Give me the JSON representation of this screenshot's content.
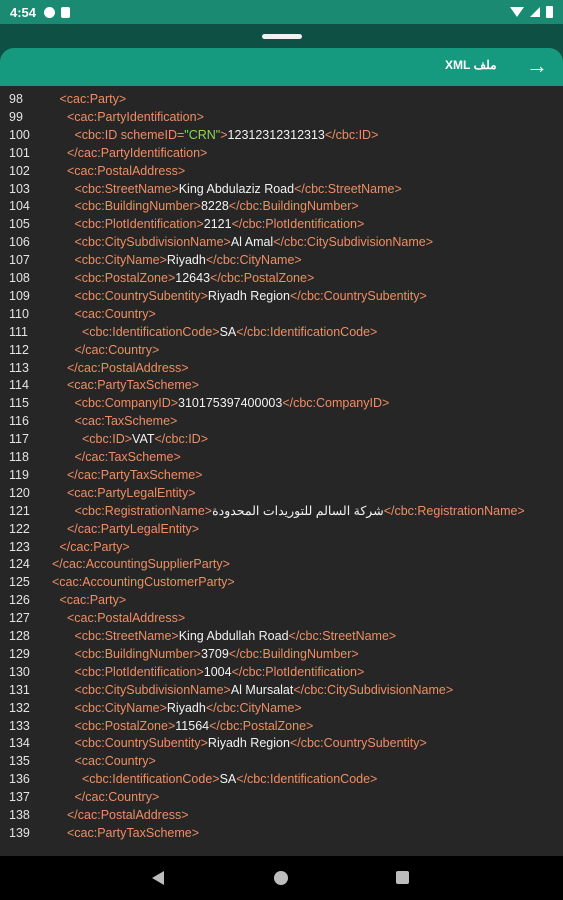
{
  "status_bar": {
    "time": "4:54"
  },
  "sheet": {
    "title": "ملف XML"
  },
  "icons": {
    "back": "arrow-right-icon",
    "nav_back": "nav-back-icon",
    "nav_home": "nav-home-icon",
    "nav_recent": "nav-recent-icon"
  },
  "colors": {
    "status_bar": "#1a8a72",
    "header": "#15997f",
    "code_bg": "#262626",
    "tag": "#ee8e64",
    "attribute_value": "#8fd45a",
    "text": "#f2f2f2"
  },
  "lines": [
    {
      "n": "98",
      "indent": 1,
      "p": [
        [
          "t",
          "<cac:Party>"
        ]
      ]
    },
    {
      "n": "99",
      "indent": 2,
      "p": [
        [
          "t",
          "<cac:PartyIdentification>"
        ]
      ]
    },
    {
      "n": "100",
      "indent": 3,
      "p": [
        [
          "t",
          "<cbc:ID schemeID="
        ],
        [
          "v",
          "\"CRN\""
        ],
        [
          "t",
          ">"
        ],
        [
          "x",
          "12312312312313"
        ],
        [
          "t",
          "</cbc:ID>"
        ]
      ]
    },
    {
      "n": "101",
      "indent": 2,
      "p": [
        [
          "t",
          "</cac:PartyIdentification>"
        ]
      ]
    },
    {
      "n": "102",
      "indent": 2,
      "p": [
        [
          "t",
          "<cac:PostalAddress>"
        ]
      ]
    },
    {
      "n": "103",
      "indent": 3,
      "p": [
        [
          "t",
          "<cbc:StreetName>"
        ],
        [
          "x",
          "King Abdulaziz Road"
        ],
        [
          "t",
          "</cbc:StreetName>"
        ]
      ]
    },
    {
      "n": "104",
      "indent": 3,
      "p": [
        [
          "t",
          "<cbc:BuildingNumber>"
        ],
        [
          "x",
          "8228"
        ],
        [
          "t",
          "</cbc:BuildingNumber>"
        ]
      ]
    },
    {
      "n": "105",
      "indent": 3,
      "p": [
        [
          "t",
          "<cbc:PlotIdentification>"
        ],
        [
          "x",
          "2121"
        ],
        [
          "t",
          "</cbc:PlotIdentification>"
        ]
      ]
    },
    {
      "n": "106",
      "indent": 3,
      "p": [
        [
          "t",
          "<cbc:CitySubdivisionName>"
        ],
        [
          "x",
          "Al Amal"
        ],
        [
          "t",
          "</cbc:CitySubdivisionName>"
        ]
      ]
    },
    {
      "n": "107",
      "indent": 3,
      "p": [
        [
          "t",
          "<cbc:CityName>"
        ],
        [
          "x",
          "Riyadh"
        ],
        [
          "t",
          "</cbc:CityName>"
        ]
      ]
    },
    {
      "n": "108",
      "indent": 3,
      "p": [
        [
          "t",
          "<cbc:PostalZone>"
        ],
        [
          "x",
          "12643"
        ],
        [
          "t",
          "</cbc:PostalZone>"
        ]
      ]
    },
    {
      "n": "109",
      "indent": 3,
      "p": [
        [
          "t",
          "<cbc:CountrySubentity>"
        ],
        [
          "x",
          "Riyadh Region"
        ],
        [
          "t",
          "</cbc:CountrySubentity>"
        ]
      ]
    },
    {
      "n": "110",
      "indent": 3,
      "p": [
        [
          "t",
          "<cac:Country>"
        ]
      ]
    },
    {
      "n": "111",
      "indent": 4,
      "p": [
        [
          "t",
          "<cbc:IdentificationCode>"
        ],
        [
          "x",
          "SA"
        ],
        [
          "t",
          "</cbc:IdentificationCode>"
        ]
      ]
    },
    {
      "n": "112",
      "indent": 3,
      "p": [
        [
          "t",
          "</cac:Country>"
        ]
      ]
    },
    {
      "n": "113",
      "indent": 2,
      "p": [
        [
          "t",
          "</cac:PostalAddress>"
        ]
      ]
    },
    {
      "n": "114",
      "indent": 2,
      "p": [
        [
          "t",
          "<cac:PartyTaxScheme>"
        ]
      ]
    },
    {
      "n": "115",
      "indent": 3,
      "p": [
        [
          "t",
          "<cbc:CompanyID>"
        ],
        [
          "x",
          "310175397400003"
        ],
        [
          "t",
          "</cbc:CompanyID>"
        ]
      ]
    },
    {
      "n": "116",
      "indent": 3,
      "p": [
        [
          "t",
          "<cac:TaxScheme>"
        ]
      ]
    },
    {
      "n": "117",
      "indent": 4,
      "p": [
        [
          "t",
          "<cbc:ID>"
        ],
        [
          "x",
          "VAT"
        ],
        [
          "t",
          "</cbc:ID>"
        ]
      ]
    },
    {
      "n": "118",
      "indent": 3,
      "p": [
        [
          "t",
          "</cac:TaxScheme>"
        ]
      ]
    },
    {
      "n": "119",
      "indent": 2,
      "p": [
        [
          "t",
          "</cac:PartyTaxScheme>"
        ]
      ]
    },
    {
      "n": "120",
      "indent": 2,
      "p": [
        [
          "t",
          "<cac:PartyLegalEntity>"
        ]
      ]
    },
    {
      "n": "121",
      "indent": 3,
      "p": [
        [
          "t",
          "<cbc:RegistrationName>"
        ],
        [
          "x",
          "شركة السالم للتوريدات المحدودة"
        ],
        [
          "t",
          "</cbc:RegistrationName>"
        ]
      ]
    },
    {
      "n": "122",
      "indent": 2,
      "p": [
        [
          "t",
          "</cac:PartyLegalEntity>"
        ]
      ]
    },
    {
      "n": "123",
      "indent": 1,
      "p": [
        [
          "t",
          "</cac:Party>"
        ]
      ]
    },
    {
      "n": "124",
      "indent": 0,
      "p": [
        [
          "t",
          "</cac:AccountingSupplierParty>"
        ]
      ]
    },
    {
      "n": "125",
      "indent": 0,
      "p": [
        [
          "t",
          "<cac:AccountingCustomerParty>"
        ]
      ]
    },
    {
      "n": "126",
      "indent": 1,
      "p": [
        [
          "t",
          "<cac:Party>"
        ]
      ]
    },
    {
      "n": "127",
      "indent": 2,
      "p": [
        [
          "t",
          "<cac:PostalAddress>"
        ]
      ]
    },
    {
      "n": "128",
      "indent": 3,
      "p": [
        [
          "t",
          "<cbc:StreetName>"
        ],
        [
          "x",
          "King Abdullah Road"
        ],
        [
          "t",
          "</cbc:StreetName>"
        ]
      ]
    },
    {
      "n": "129",
      "indent": 3,
      "p": [
        [
          "t",
          "<cbc:BuildingNumber>"
        ],
        [
          "x",
          "3709"
        ],
        [
          "t",
          "</cbc:BuildingNumber>"
        ]
      ]
    },
    {
      "n": "130",
      "indent": 3,
      "p": [
        [
          "t",
          "<cbc:PlotIdentification>"
        ],
        [
          "x",
          "1004"
        ],
        [
          "t",
          "</cbc:PlotIdentification>"
        ]
      ]
    },
    {
      "n": "131",
      "indent": 3,
      "p": [
        [
          "t",
          "<cbc:CitySubdivisionName>"
        ],
        [
          "x",
          "Al Mursalat"
        ],
        [
          "t",
          "</cbc:CitySubdivisionName>"
        ]
      ]
    },
    {
      "n": "132",
      "indent": 3,
      "p": [
        [
          "t",
          "<cbc:CityName>"
        ],
        [
          "x",
          "Riyadh"
        ],
        [
          "t",
          "</cbc:CityName>"
        ]
      ]
    },
    {
      "n": "133",
      "indent": 3,
      "p": [
        [
          "t",
          "<cbc:PostalZone>"
        ],
        [
          "x",
          "11564"
        ],
        [
          "t",
          "</cbc:PostalZone>"
        ]
      ]
    },
    {
      "n": "134",
      "indent": 3,
      "p": [
        [
          "t",
          "<cbc:CountrySubentity>"
        ],
        [
          "x",
          "Riyadh Region"
        ],
        [
          "t",
          "</cbc:CountrySubentity>"
        ]
      ]
    },
    {
      "n": "135",
      "indent": 3,
      "p": [
        [
          "t",
          "<cac:Country>"
        ]
      ]
    },
    {
      "n": "136",
      "indent": 4,
      "p": [
        [
          "t",
          "<cbc:IdentificationCode>"
        ],
        [
          "x",
          "SA"
        ],
        [
          "t",
          "</cbc:IdentificationCode>"
        ]
      ]
    },
    {
      "n": "137",
      "indent": 3,
      "p": [
        [
          "t",
          "</cac:Country>"
        ]
      ]
    },
    {
      "n": "138",
      "indent": 2,
      "p": [
        [
          "t",
          "</cac:PostalAddress>"
        ]
      ]
    },
    {
      "n": "139",
      "indent": 2,
      "p": [
        [
          "t",
          "<cac:PartyTaxScheme>"
        ]
      ]
    }
  ]
}
